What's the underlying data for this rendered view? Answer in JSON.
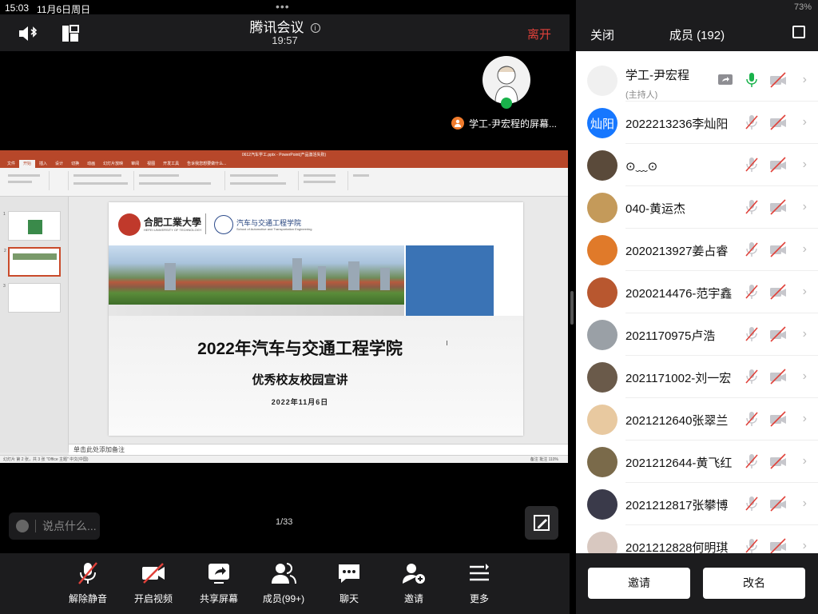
{
  "status": {
    "time": "15:03",
    "date": "11月6日周日",
    "battery": "73%"
  },
  "header": {
    "title": "腾讯会议",
    "timer": "19:57",
    "leave": "离开",
    "info_icon": "i"
  },
  "host_label": "学工-尹宏程的屏幕...",
  "shared": {
    "ppt_title": "0612汽车学工.pptx - PowerPoint(产品激活失败)",
    "menu": [
      "文件",
      "开始",
      "插入",
      "设计",
      "切换",
      "动画",
      "幻灯片放映",
      "审阅",
      "视图",
      "开发工具",
      "告诉我您想要做什么..."
    ],
    "slide": {
      "logo1": "合肥工業大學",
      "logo1_sub": "HEFEI UNIVERSITY OF TECHNOLOGY",
      "logo2": "汽车与交通工程学院",
      "logo2_sub": "School of Automotive and Transportation Engineering",
      "title": "2022年汽车与交通工程学院",
      "subtitle": "优秀校友校园宣讲",
      "date": "2022年11月6日"
    },
    "notes": "单击此处添加备注",
    "status_left": "幻灯片 第 2 张，共 3 张    \"Office 主题\"    中文(中国)",
    "status_right": "备注   批注   110%"
  },
  "comment_placeholder": "说点什么...",
  "page_indicator": "1/33",
  "toolbar": [
    {
      "label": "解除静音",
      "icon": "mic-muted-icon"
    },
    {
      "label": "开启视频",
      "icon": "video-off-icon"
    },
    {
      "label": "共享屏幕",
      "icon": "share-screen-icon"
    },
    {
      "label": "成员(99+)",
      "icon": "members-icon"
    },
    {
      "label": "聊天",
      "icon": "chat-icon"
    },
    {
      "label": "邀请",
      "icon": "invite-icon"
    },
    {
      "label": "更多",
      "icon": "more-icon"
    }
  ],
  "panel": {
    "close": "关闭",
    "title": "成员 (192)",
    "invite": "邀请",
    "rename": "改名",
    "members": [
      {
        "name": "学工-尹宏程",
        "role": "(主持人)",
        "sharing": true,
        "mic_on": true,
        "avatar_color": "#f0f0f0"
      },
      {
        "name": "2022213236李灿阳",
        "avatar_text": "灿阳",
        "avatar_color": "#1677ff",
        "mic_on": false
      },
      {
        "name": "⊙﹏⊙",
        "avatar_color": "#5a4a3a",
        "mic_on": false
      },
      {
        "name": "040-黄运杰",
        "avatar_color": "#c49a5a",
        "mic_on": false
      },
      {
        "name": "2020213927姜占睿",
        "avatar_color": "#e07a2a",
        "mic_on": false
      },
      {
        "name": "2020214476-范宇鑫",
        "avatar_color": "#b8572f",
        "mic_on": false
      },
      {
        "name": "2021170975卢浩",
        "avatar_color": "#9aa0a6",
        "mic_on": false
      },
      {
        "name": "2021171002-刘一宏",
        "avatar_color": "#6a5a4a",
        "mic_on": false
      },
      {
        "name": "2021212640张翠兰",
        "avatar_color": "#e8c9a0",
        "mic_on": false
      },
      {
        "name": "2021212644-黄飞红",
        "avatar_color": "#7a6a4a",
        "mic_on": false
      },
      {
        "name": "2021212817张攀博",
        "avatar_color": "#3a3a4a",
        "mic_on": false
      },
      {
        "name": "2021212828何明琪",
        "avatar_color": "#d8c8c0",
        "mic_on": false
      }
    ]
  }
}
